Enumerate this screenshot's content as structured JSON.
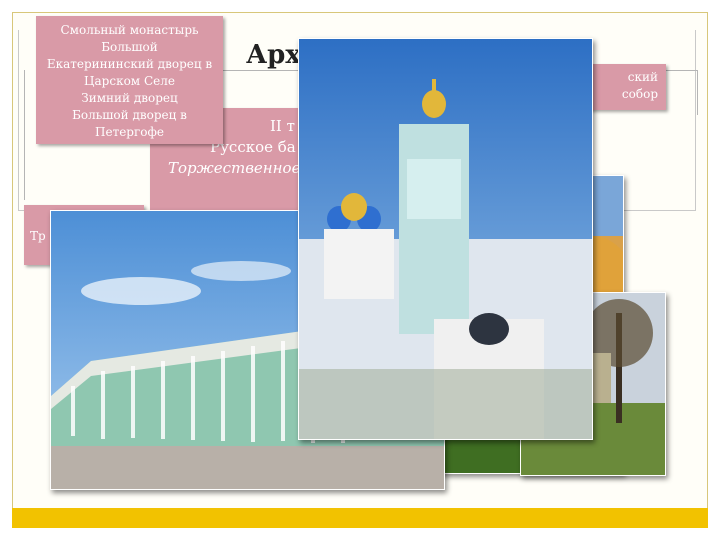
{
  "slide": {
    "title": "Арх",
    "box_a": {
      "lines": [
        "Смольный монастырь",
        "Большой",
        "Екатерининский дворец в",
        "Царском Селе",
        "Зимний дворец",
        "Большой дворец в",
        "Петергофе"
      ]
    },
    "box_b": {
      "lines": [
        "ский",
        "собор"
      ]
    },
    "box_c": {
      "text": "Тр"
    },
    "box_d": {
      "line1": "II т",
      "line2": "Русское ба",
      "line3": "Торжественное"
    }
  },
  "colors": {
    "box": "#d99aa7",
    "accent_bar": "#f2c200",
    "frame": "#d8c77a"
  }
}
